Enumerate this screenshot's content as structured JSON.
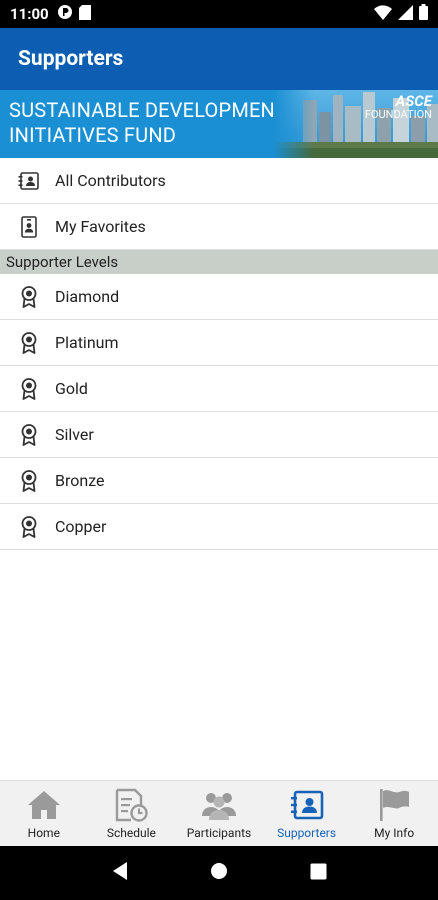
{
  "status_bar": {
    "time": "11:00",
    "left_icons": [
      "notification-circle-icon",
      "sim-card-icon"
    ],
    "right_icons": [
      "wifi-icon",
      "signal-icon",
      "battery-icon"
    ]
  },
  "app_bar": {
    "title": "Supporters"
  },
  "banner": {
    "line1": "SUSTAINABLE DEVELOPMENT",
    "line2": "INITIATIVES FUND",
    "logo_top": "ASCE",
    "logo_bottom": "FOUNDATION"
  },
  "top_items": [
    {
      "label": "All Contributors",
      "icon": "contacts-card-icon"
    },
    {
      "label": "My Favorites",
      "icon": "badge-person-icon"
    }
  ],
  "section_header": "Supporter Levels",
  "levels": [
    {
      "label": "Diamond",
      "icon": "award-ribbon-icon"
    },
    {
      "label": "Platinum",
      "icon": "award-ribbon-icon"
    },
    {
      "label": "Gold",
      "icon": "award-ribbon-icon"
    },
    {
      "label": "Silver",
      "icon": "award-ribbon-icon"
    },
    {
      "label": "Bronze",
      "icon": "award-ribbon-icon"
    },
    {
      "label": "Copper",
      "icon": "award-ribbon-icon"
    }
  ],
  "tabs": [
    {
      "label": "Home",
      "icon": "home-icon",
      "active": false
    },
    {
      "label": "Schedule",
      "icon": "schedule-icon",
      "active": false
    },
    {
      "label": "Participants",
      "icon": "people-icon",
      "active": false
    },
    {
      "label": "Supporters",
      "icon": "contacts-card-icon",
      "active": true
    },
    {
      "label": "My Info",
      "icon": "flag-icon",
      "active": false
    }
  ],
  "nav_bar": [
    "back-icon",
    "home-circle-icon",
    "recents-icon"
  ],
  "colors": {
    "app_bar": "#0d5eb3",
    "banner": "#1a8fd3",
    "section_header": "#c7cfc8",
    "active_tab": "#1663b7",
    "tab_icon": "#9a9a9a"
  }
}
